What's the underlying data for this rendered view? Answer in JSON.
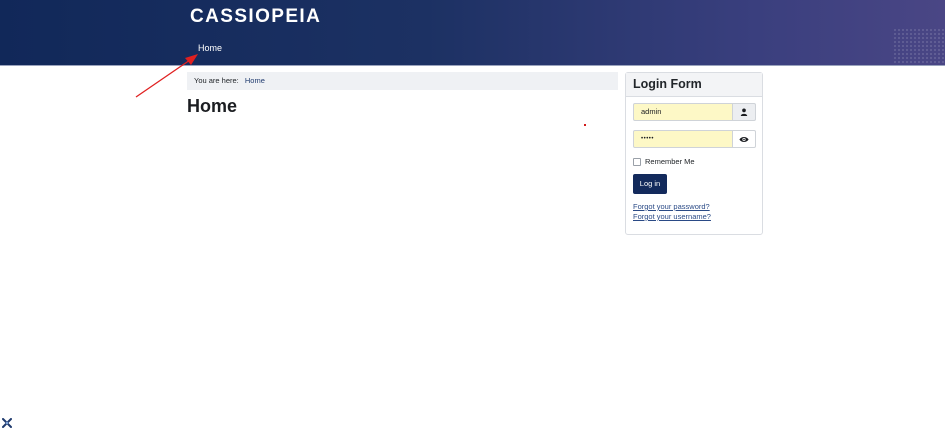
{
  "site": {
    "logo": "CASSIOPEIA",
    "nav": {
      "home": "Home"
    }
  },
  "breadcrumb": {
    "label": "You are here:",
    "current": "Home"
  },
  "main": {
    "title": "Home"
  },
  "login": {
    "title": "Login Form",
    "username_value": "admin",
    "password_value": "•••••",
    "username_icon": "user-icon",
    "password_icon": "eye-icon",
    "remember_label": "Remember Me",
    "remember_checked": false,
    "submit_label": "Log in",
    "forgot_password": "Forgot your password?",
    "forgot_username": "Forgot your username?"
  },
  "colors": {
    "header_start": "#112859",
    "header_end": "#4a4685",
    "button": "#132a5c",
    "link": "#2a4a86",
    "autofill": "#fdf8c6",
    "annotation": "#e02020"
  },
  "icons": {
    "joomla": "joomla-icon",
    "annotation": "arrow-annotation"
  }
}
